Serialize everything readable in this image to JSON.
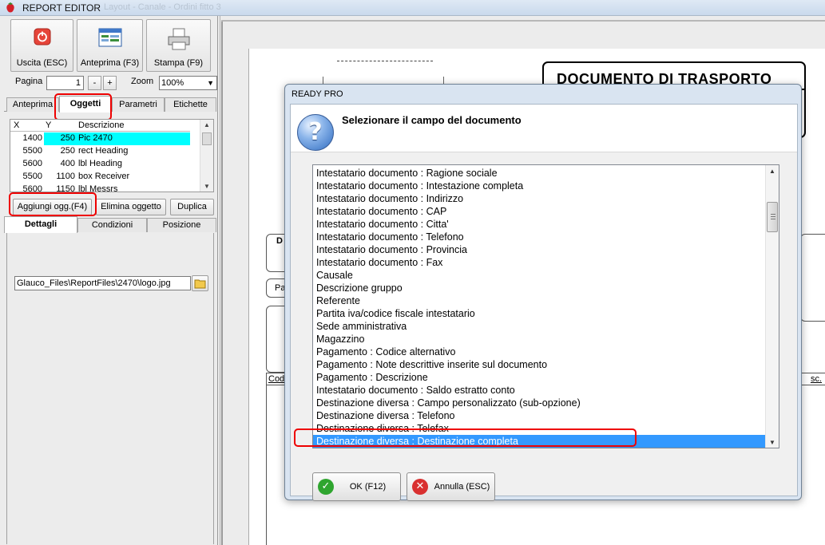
{
  "window": {
    "title": "REPORT EDITOR",
    "ghost_text": "Layout  -  Canale  -  Ordini fitto 3"
  },
  "toolbar": {
    "exit_label": "Uscita (ESC)",
    "preview_label": "Anteprima (F3)",
    "print_label": "Stampa (F9)"
  },
  "page_controls": {
    "page_label": "Pagina",
    "page_value": "1",
    "minus": "-",
    "plus": "+",
    "zoom_label": "Zoom",
    "zoom_value": "100%"
  },
  "top_tabs": [
    "Anteprima",
    "Oggetti",
    "Parametri",
    "Etichette"
  ],
  "objects_table": {
    "columns": [
      "X",
      "Y",
      "Descrizione"
    ],
    "rows": [
      {
        "x": "1400",
        "y": "250",
        "desc": "Pic 2470"
      },
      {
        "x": "5500",
        "y": "250",
        "desc": "rect Heading"
      },
      {
        "x": "5600",
        "y": "400",
        "desc": "lbl Heading"
      },
      {
        "x": "5500",
        "y": "1100",
        "desc": "box Receiver"
      },
      {
        "x": "5600",
        "y": "1150",
        "desc": "lbl Messrs"
      }
    ]
  },
  "object_buttons": {
    "add": "Aggiungi ogg.(F4)",
    "remove": "Elimina oggetto",
    "duplicate": "Duplica"
  },
  "detail_tabs": [
    "Dettagli",
    "Condizioni",
    "Posizione"
  ],
  "file_path": "Glauco_Files\\ReportFiles\\2470\\logo.jpg",
  "canvas": {
    "doc_title": "DOCUMENTO DI TRASPORTO",
    "label_d": "D",
    "label_pa": "Pa",
    "label_cod": "Cod",
    "label_sc": "sc."
  },
  "dialog": {
    "title": "READY PRO",
    "question": "Selezionare il campo del documento",
    "items": [
      "Intestatario documento : Ragione sociale",
      "Intestatario documento : Intestazione completa",
      "Intestatario documento : Indirizzo",
      "Intestatario documento : CAP",
      "Intestatario documento : Citta'",
      "Intestatario documento : Telefono",
      "Intestatario documento : Provincia",
      "Intestatario documento : Fax",
      "Causale",
      "Descrizione gruppo",
      "Referente",
      "Partita iva/codice fiscale intestatario",
      "Sede amministrativa",
      "Magazzino",
      "Pagamento : Codice alternativo",
      "Pagamento : Note descrittive inserite sul documento",
      "Pagamento : Descrizione",
      "Intestatario documento : Saldo estratto conto",
      "Destinazione diversa : Campo personalizzato (sub-opzione)",
      "Destinazione diversa : Telefono",
      "Destinazione diversa : Telefax",
      "Destinazione diversa : Destinazione completa"
    ],
    "selected_item": "Destinazione diversa : Destinazione completa",
    "ok_label": "OK (F12)",
    "cancel_label": "Annulla (ESC)"
  },
  "colors": {
    "selection": "#3399ff",
    "highlight_row": "#00ffff",
    "annotation": "#e00000"
  }
}
